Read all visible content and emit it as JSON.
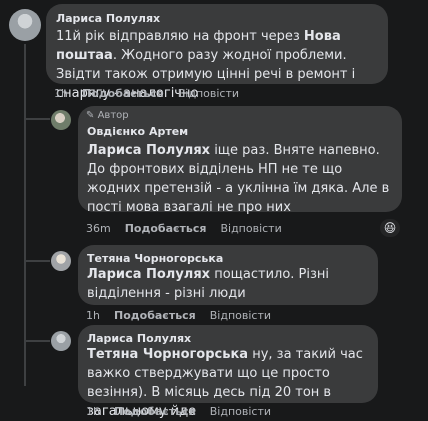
{
  "comments": [
    {
      "author": "Лариса Полулях",
      "text_parts": [
        "11й рік відправляю на фронт через ",
        "Нова поштаа",
        ". Жодного разу жодної проблеми. Звідти також отримую цінні речі в ремонт і снарягу - аналогічно"
      ],
      "time": "1h",
      "like": "Подобається",
      "reply": "Відповісти"
    },
    {
      "badge": "Автор",
      "author": "Овдієнко Артем",
      "tag": "Лариса Полулях",
      "text": " іще раз. Вняте напевно. До фронтових відділень НП не те що жодних претензій - а уклінна їм дяка. Але в пості мова взагалі не про них",
      "time": "36m",
      "like": "Подобається",
      "reply": "Відповісти"
    },
    {
      "author": "Тетяна Чорногорська",
      "tag": "Лариса Полулях",
      "text": " пощастило. Різні відділення - різні люди",
      "time": "1h",
      "like": "Подобається",
      "reply": "Відповісти"
    },
    {
      "author": "Лариса Полулях",
      "tag": "Тетяна Чорногорська",
      "text": " ну, за такий час важко стверджувати що це просто везіння). В місяць десь під 20 тон в загальному йде",
      "time": "1h",
      "like": "Подобається",
      "reply": "Відповісти"
    }
  ],
  "reaction_icon": "laughing-emoji-icon",
  "colors": {
    "background": "#18191a",
    "bubble": "#3a3b3c",
    "meta": "#b0b3b8",
    "text": "#e4e6eb"
  }
}
